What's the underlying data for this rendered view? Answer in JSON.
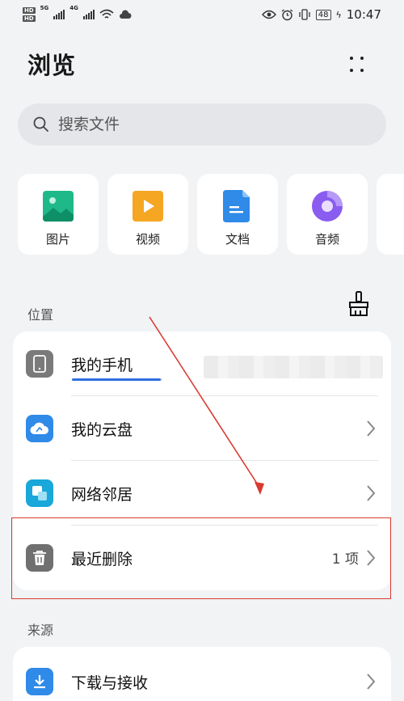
{
  "status_bar": {
    "hd_labels": [
      "HD",
      "HD"
    ],
    "network_1": "5G",
    "network_2": "4G",
    "battery": "48",
    "time": "10:47"
  },
  "header": {
    "title": "浏览"
  },
  "search": {
    "placeholder": "搜索文件"
  },
  "categories": [
    {
      "label": "图片",
      "icon": "image-icon",
      "color": "#1fb889"
    },
    {
      "label": "视频",
      "icon": "video-icon",
      "color": "#f5a623"
    },
    {
      "label": "文档",
      "icon": "document-icon",
      "color": "#2f8ae8"
    },
    {
      "label": "音频",
      "icon": "audio-icon",
      "color": "#8a5cf0"
    }
  ],
  "locations": {
    "section_title": "位置",
    "items": [
      {
        "label": "我的手机",
        "icon": "phone-icon",
        "storage_used": 0.98
      },
      {
        "label": "我的云盘",
        "icon": "cloud-icon"
      },
      {
        "label": "网络邻居",
        "icon": "network-icon"
      },
      {
        "label": "最近删除",
        "icon": "trash-icon",
        "count": "1 项"
      }
    ]
  },
  "sources": {
    "section_title": "来源",
    "items": [
      {
        "label": "下载与接收",
        "icon": "download-icon"
      }
    ]
  },
  "colors": {
    "accent": "#2f6fe0",
    "annotation": "#d93a30"
  }
}
